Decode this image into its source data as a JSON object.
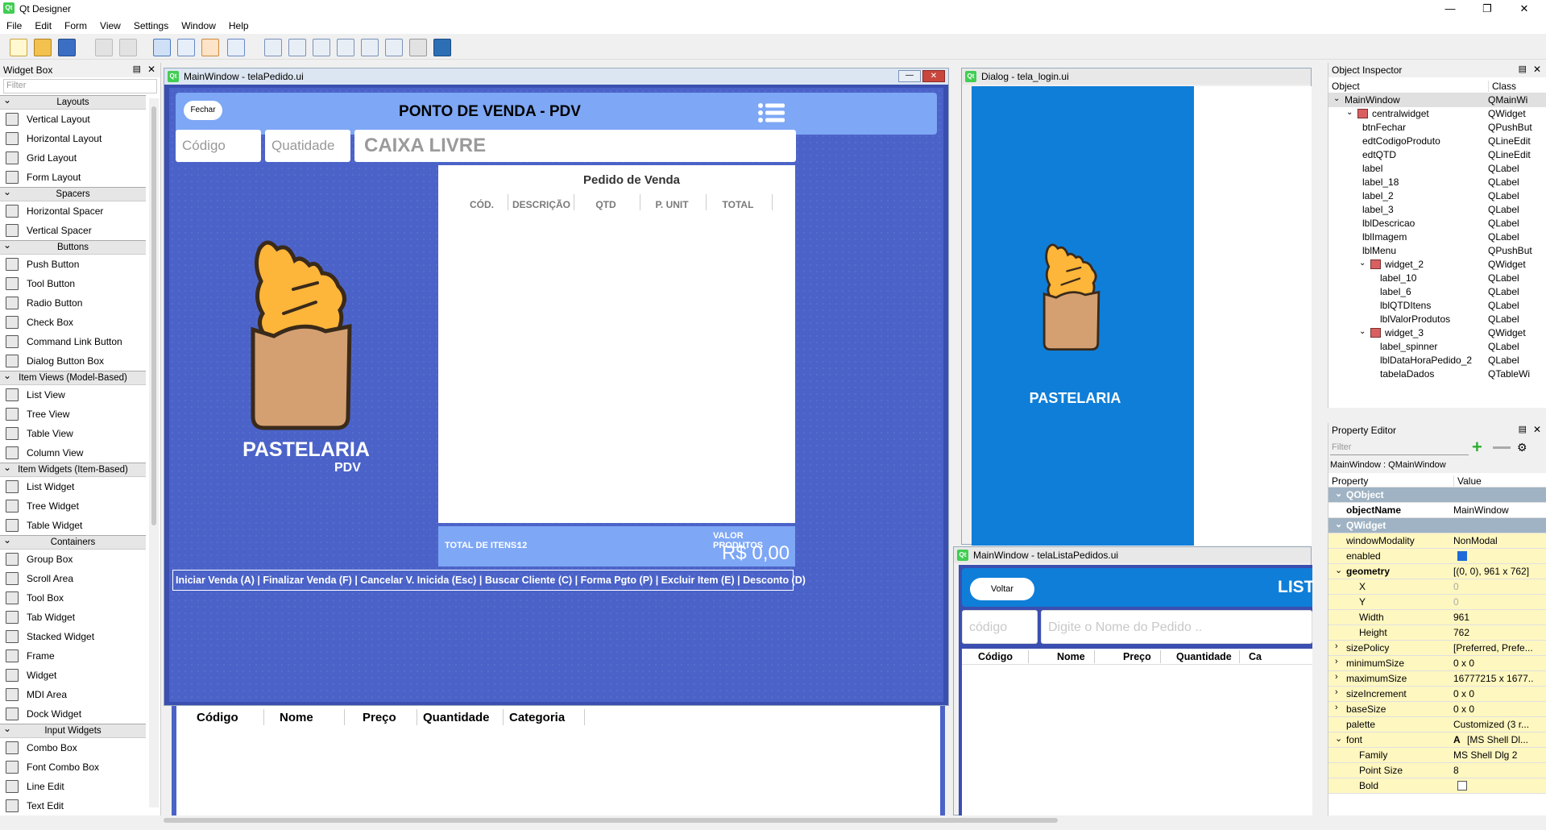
{
  "app": {
    "title": "Qt Designer",
    "logo": "Qt"
  },
  "menu": [
    "File",
    "Edit",
    "Form",
    "View",
    "Settings",
    "Window",
    "Help"
  ],
  "widget_box": {
    "title": "Widget Box",
    "filter_placeholder": "Filter",
    "categories": [
      {
        "name": "Layouts",
        "items": [
          "Vertical Layout",
          "Horizontal Layout",
          "Grid Layout",
          "Form Layout"
        ]
      },
      {
        "name": "Spacers",
        "items": [
          "Horizontal Spacer",
          "Vertical Spacer"
        ]
      },
      {
        "name": "Buttons",
        "items": [
          "Push Button",
          "Tool Button",
          "Radio Button",
          "Check Box",
          "Command Link Button",
          "Dialog Button Box"
        ]
      },
      {
        "name": "Item Views (Model-Based)",
        "items": [
          "List View",
          "Tree View",
          "Table View",
          "Column View"
        ]
      },
      {
        "name": "Item Widgets (Item-Based)",
        "items": [
          "List Widget",
          "Tree Widget",
          "Table Widget"
        ]
      },
      {
        "name": "Containers",
        "items": [
          "Group Box",
          "Scroll Area",
          "Tool Box",
          "Tab Widget",
          "Stacked Widget",
          "Frame",
          "Widget",
          "MDI Area",
          "Dock Widget"
        ]
      },
      {
        "name": "Input Widgets",
        "items": [
          "Combo Box",
          "Font Combo Box",
          "Line Edit",
          "Text Edit"
        ]
      }
    ]
  },
  "pdv_window": {
    "title": "MainWindow - telaPedido.ui",
    "fechar": "Fechar",
    "header": "PONTO DE VENDA - PDV",
    "codigo_placeholder": "Código",
    "qtd_placeholder": "Quatidade",
    "caixa": "CAIXA LIVRE",
    "brand": "PASTELARIA",
    "brand_sub": "PDV",
    "pedido_title": "Pedido de Venda",
    "columns": [
      "CÓD.",
      "DESCRIÇÃO",
      "QTD",
      "P. UNIT",
      "TOTAL"
    ],
    "total_itens_label": "TOTAL DE ITENS:",
    "total_itens_value": "12",
    "valor_label": "VALOR PRODUTOS",
    "valor_value": "R$ 0,00",
    "shortcuts": [
      "Iniciar Venda (A)",
      "Finalizar Venda (F)",
      "Cancelar V. Inicida (Esc)",
      "Buscar Cliente (C)",
      "Forma Pgto (P)",
      "Excluir Item (E)",
      "Desconto (D)"
    ],
    "bg_table_columns": [
      "Código",
      "Nome",
      "Preço",
      "Quantidade",
      "Categoria"
    ]
  },
  "login_window": {
    "title": "Dialog - tela_login.ui",
    "brand": "PASTELARIA"
  },
  "lista_window": {
    "title": "MainWindow - telaListaPedidos.ui",
    "voltar": "Voltar",
    "header": "LIST",
    "codigo_placeholder": "código",
    "search_placeholder": "Digite o Nome do Pedido ..",
    "columns": [
      "Código",
      "Nome",
      "Preço",
      "Quantidade",
      "Ca"
    ]
  },
  "object_inspector": {
    "title": "Object Inspector",
    "col_object": "Object",
    "col_class": "Class",
    "rows": [
      {
        "name": "MainWindow",
        "cls": "QMainWi",
        "level": 0,
        "toggle": true
      },
      {
        "name": "centralwidget",
        "cls": "QWidget",
        "level": 1,
        "toggle": true
      },
      {
        "name": "btnFechar",
        "cls": "QPushBut",
        "level": 2
      },
      {
        "name": "edtCodigoProduto",
        "cls": "QLineEdit",
        "level": 2
      },
      {
        "name": "edtQTD",
        "cls": "QLineEdit",
        "level": 2
      },
      {
        "name": "label",
        "cls": "QLabel",
        "level": 2
      },
      {
        "name": "label_18",
        "cls": "QLabel",
        "level": 2
      },
      {
        "name": "label_2",
        "cls": "QLabel",
        "level": 2
      },
      {
        "name": "label_3",
        "cls": "QLabel",
        "level": 2
      },
      {
        "name": "lblDescricao",
        "cls": "QLabel",
        "level": 2
      },
      {
        "name": "lblImagem",
        "cls": "QLabel",
        "level": 2
      },
      {
        "name": "lblMenu",
        "cls": "QPushBut",
        "level": 2
      },
      {
        "name": "widget_2",
        "cls": "QWidget",
        "level": 2,
        "toggle": true
      },
      {
        "name": "label_10",
        "cls": "QLabel",
        "level": 3
      },
      {
        "name": "label_6",
        "cls": "QLabel",
        "level": 3
      },
      {
        "name": "lblQTDItens",
        "cls": "QLabel",
        "level": 3
      },
      {
        "name": "lblValorProdutos",
        "cls": "QLabel",
        "level": 3
      },
      {
        "name": "widget_3",
        "cls": "QWidget",
        "level": 2,
        "toggle": true
      },
      {
        "name": "label_spinner",
        "cls": "QLabel",
        "level": 3
      },
      {
        "name": "lblDataHoraPedido_2",
        "cls": "QLabel",
        "level": 3
      },
      {
        "name": "tabelaDados",
        "cls": "QTableWi",
        "level": 3
      }
    ]
  },
  "property_editor": {
    "title": "Property Editor",
    "filter_placeholder": "Filter",
    "context": "MainWindow : QMainWindow",
    "col_property": "Property",
    "col_value": "Value",
    "rows": [
      {
        "kind": "group",
        "name": "QObject"
      },
      {
        "kind": "prop",
        "name": "objectName",
        "value": "MainWindow",
        "bold": true
      },
      {
        "kind": "group",
        "name": "QWidget"
      },
      {
        "kind": "prop",
        "name": "windowModality",
        "value": "NonModal"
      },
      {
        "kind": "check",
        "name": "enabled",
        "checked": true
      },
      {
        "kind": "prop",
        "name": "geometry",
        "value": "[(0, 0), 961 x 762]",
        "bold": true,
        "expander": "open"
      },
      {
        "kind": "sub",
        "name": "X",
        "value": "0",
        "dim": true
      },
      {
        "kind": "sub",
        "name": "Y",
        "value": "0",
        "dim": true
      },
      {
        "kind": "sub",
        "name": "Width",
        "value": "961"
      },
      {
        "kind": "sub",
        "name": "Height",
        "value": "762"
      },
      {
        "kind": "prop",
        "name": "sizePolicy",
        "value": "[Preferred, Prefe...",
        "expander": "closed"
      },
      {
        "kind": "prop",
        "name": "minimumSize",
        "value": "0 x 0",
        "expander": "closed"
      },
      {
        "kind": "prop",
        "name": "maximumSize",
        "value": "16777215 x 1677...",
        "expander": "closed"
      },
      {
        "kind": "prop",
        "name": "sizeIncrement",
        "value": "0 x 0",
        "expander": "closed"
      },
      {
        "kind": "prop",
        "name": "baseSize",
        "value": "0 x 0",
        "expander": "closed"
      },
      {
        "kind": "prop",
        "name": "palette",
        "value": "Customized (3 r..."
      },
      {
        "kind": "prop",
        "name": "font",
        "value": "[MS Shell Dl...",
        "icon": "A",
        "expander": "open"
      },
      {
        "kind": "sub",
        "name": "Family",
        "value": "MS Shell Dlg 2"
      },
      {
        "kind": "sub",
        "name": "Point Size",
        "value": "8"
      },
      {
        "kind": "subcheck",
        "name": "Bold",
        "checked": false
      }
    ]
  }
}
